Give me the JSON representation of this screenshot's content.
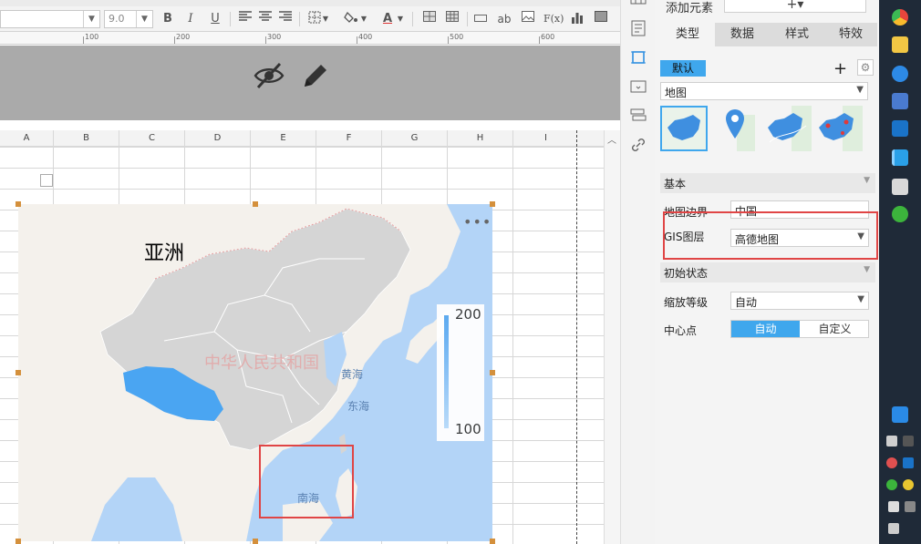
{
  "toolbar": {
    "font_size": "9.0",
    "bold": "B",
    "italic": "I",
    "underline": "U",
    "text_color_glyph": "A",
    "text_tool": "ab",
    "formula": "F(x)"
  },
  "ruler": {
    "labels": [
      "100",
      "200",
      "300",
      "400",
      "500",
      "600"
    ]
  },
  "columns": [
    "A",
    "B",
    "C",
    "D",
    "E",
    "F",
    "G",
    "H",
    "I"
  ],
  "map": {
    "title": "亚洲",
    "more": "•••",
    "watermark": "中华人民共和国",
    "seas": {
      "yellow_sea": "黄海",
      "east_sea": "东海",
      "south_sea": "南海"
    },
    "legend": {
      "max": "200",
      "min": "100"
    },
    "colors": {
      "water": "#b3d4f7",
      "land": "#f4f1ec",
      "region": "#d5d5d5",
      "highlight": "#4aa5f2"
    }
  },
  "panel": {
    "add_element_label": "添加元素",
    "add_element_symbol": "+▾",
    "tabs": [
      "类型",
      "数据",
      "样式",
      "特效"
    ],
    "active_tab": "类型",
    "style_tag": "默认",
    "add_style": "+",
    "chart_type": "地图",
    "section_basic": "基本",
    "map_boundary_label": "地图边界",
    "map_boundary_value": "中国",
    "gis_layer_label": "GIS图层",
    "gis_layer_value": "高德地图",
    "section_initial": "初始状态",
    "zoom_label": "缩放等级",
    "zoom_value": "自动",
    "center_label": "中心点",
    "center_options": [
      "自动",
      "自定义"
    ],
    "accent_color": "#3fa7ed"
  }
}
